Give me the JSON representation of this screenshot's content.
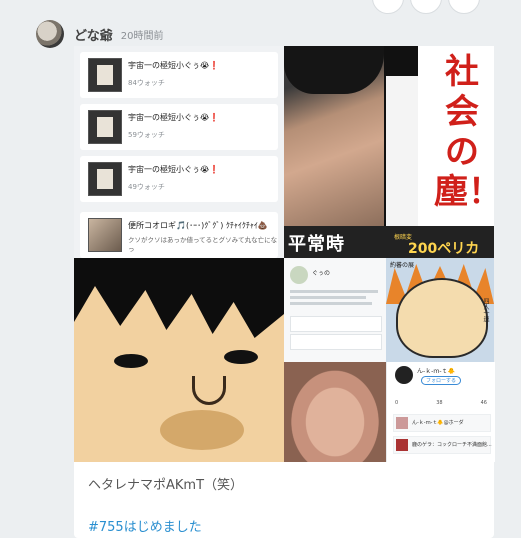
{
  "post": {
    "username": "どな爺",
    "time": "20時間前",
    "caption": "ヘタレナマポAKmT（笑）",
    "hashtag": "#755はじめました"
  },
  "list_items": [
    {
      "title": "宇宙一の極短小ぐぅ😭❗",
      "views": "84ウォッチ"
    },
    {
      "title": "宇宙一の極短小ぐぅ😭❗",
      "views": "59ウォッチ"
    },
    {
      "title": "宇宙一の極短小ぐぅ😭❗",
      "views": "49ウォッチ"
    },
    {
      "title": "便所コオロギ🎵(･ｰ･)ｸﾞｸﾞ) ｸﾁｬｲｸﾁｬｲ💩",
      "desc": "クソがクソはあっか値ってるとグソみて丸な亡になっ"
    }
  ],
  "poster": {
    "label": "平常時",
    "price_label": "根暗変",
    "price": "200ペリカ",
    "slogan": "社会の塵！"
  },
  "mini_profile": {
    "name": "ぐぅの"
  },
  "manga": {
    "title": "約蕃の展",
    "sub": "四人一連"
  },
  "profile_ui": {
    "name": "ん-ｋ-ｍ-ｔ🐥",
    "follow": "フォローする",
    "stats": [
      "0",
      "38",
      "46"
    ],
    "rows": [
      {
        "text": "ん-ｋ-ｍ-ｔ🐥@ホーダ"
      },
      {
        "text": "鹿のゲラ：コックローチ不満面館..."
      }
    ]
  },
  "icons": [
    "retweet-icon",
    "heart-icon",
    "more-icon"
  ]
}
